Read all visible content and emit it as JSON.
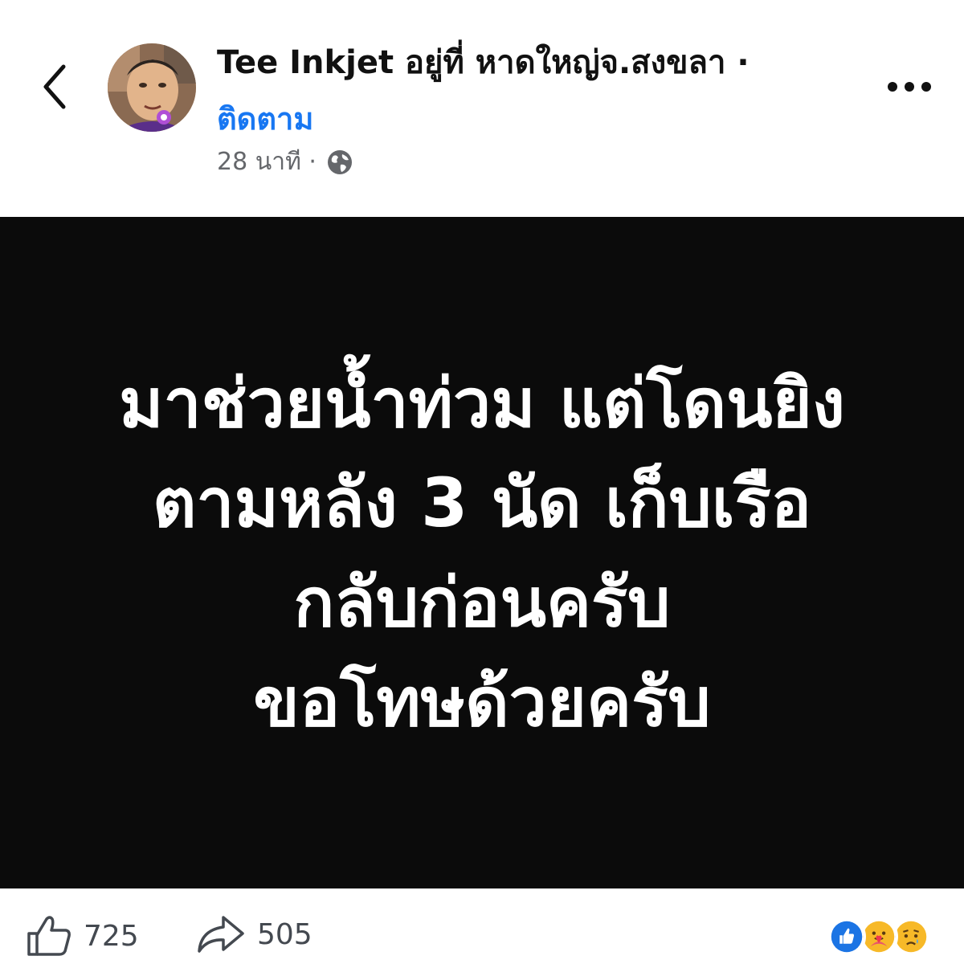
{
  "header": {
    "author_name": "Tee Inkjet",
    "location_text": " อยู่ที่ หาดใหญ่จ.สงขลา ·",
    "follow_label": "ติดตาม",
    "timestamp": "28 นาที ·",
    "back_icon": "chevron-left-icon",
    "more_icon": "more-dots-icon",
    "privacy_icon": "globe-icon"
  },
  "post": {
    "background_color": "#0b0b0b",
    "text_color": "#ffffff",
    "lines": [
      "มาช่วยน้ำท่วม แต่โดนยิง",
      "ตามหลัง 3 นัด  เก็บเรือ",
      "กลับก่อนครับ",
      "ขอโทษด้วยครับ"
    ]
  },
  "footer": {
    "like_count": "725",
    "share_count": "505",
    "like_icon": "thumbs-up-icon",
    "share_icon": "share-arrow-icon",
    "reactions": [
      "like-reaction-icon",
      "care-reaction-icon",
      "sad-reaction-icon"
    ]
  },
  "colors": {
    "accent": "#1877f2",
    "muted": "#65676b"
  }
}
